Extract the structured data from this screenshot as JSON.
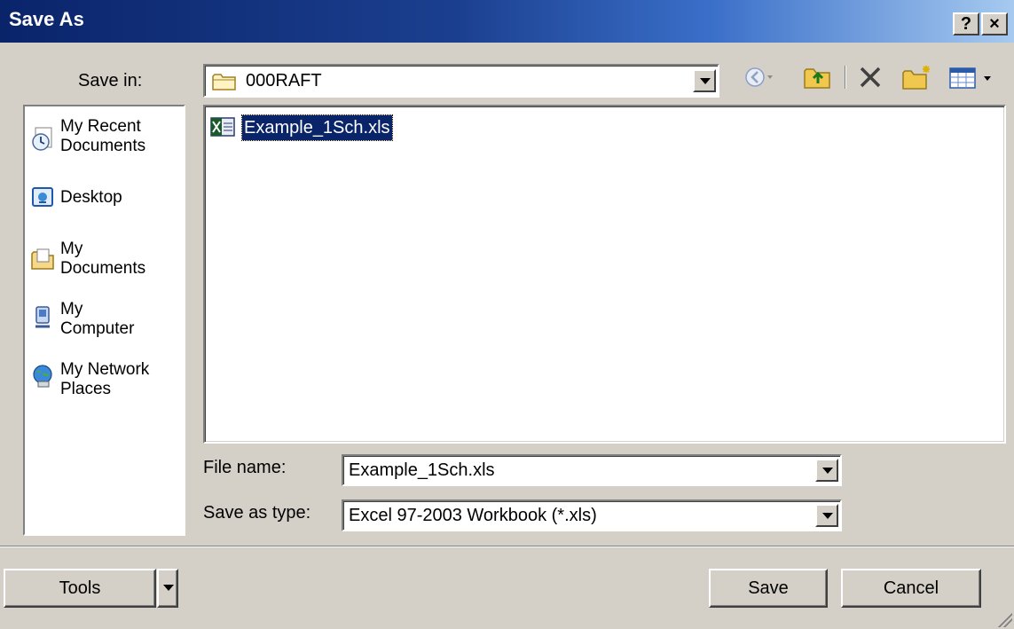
{
  "window": {
    "title": "Save As",
    "help_label": "?",
    "close_label": "×"
  },
  "top": {
    "save_in_label": "Save in:",
    "save_in_value": "000RAFT",
    "toolbar_icons": [
      "back-icon",
      "up-folder-icon",
      "delete-icon",
      "new-folder-icon",
      "views-icon"
    ]
  },
  "places": [
    {
      "icon": "recent-documents-icon",
      "line1": "My Recent",
      "line2": "Documents"
    },
    {
      "icon": "desktop-icon",
      "line1": "Desktop",
      "line2": ""
    },
    {
      "icon": "my-documents-icon",
      "line1": "My",
      "line2": "Documents"
    },
    {
      "icon": "my-computer-icon",
      "line1": "My",
      "line2": "Computer"
    },
    {
      "icon": "network-places-icon",
      "line1": "My Network",
      "line2": "Places"
    }
  ],
  "files": [
    {
      "name": "Example_1Sch.xls",
      "icon": "excel-file-icon",
      "selected": true
    }
  ],
  "form": {
    "file_name_label": "File name:",
    "file_name_value": "Example_1Sch.xls",
    "save_type_label": "Save as type:",
    "save_type_value": "Excel 97-2003 Workbook (*.xls)"
  },
  "buttons": {
    "tools": "Tools",
    "save": "Save",
    "cancel": "Cancel"
  },
  "colors": {
    "titlebar": "#0a246a",
    "dialog_face": "#d4d0c8",
    "selection": "#0a246a"
  }
}
